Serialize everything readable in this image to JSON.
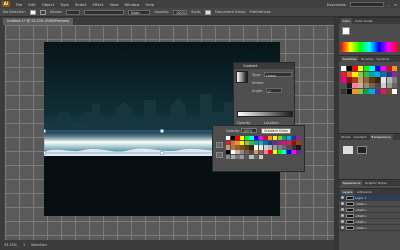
{
  "menubar": {
    "logo": "Ai",
    "items": [
      "File",
      "Edit",
      "Object",
      "Type",
      "Select",
      "Effect",
      "View",
      "Window",
      "Help"
    ],
    "workspace": "Essentials"
  },
  "controlbar": {
    "selection_label": "No Selection",
    "stroke_label": "Stroke:",
    "brush_value": "Basic",
    "opacity_label": "Opacity:",
    "opacity_value": "100%",
    "style_label": "Style:",
    "doc_setup": "Document Setup",
    "preferences": "Preferences"
  },
  "document": {
    "tab_title": "Untitled-1* @ 33.33% (RGB/Preview)"
  },
  "status": {
    "zoom": "33.33%",
    "page": "1",
    "tool": "Selection"
  },
  "gradient_panel": {
    "title": "Gradient",
    "type_label": "Type:",
    "type_value": "Linear",
    "stroke_label": "Stroke:",
    "angle_label": "Angle:",
    "angle_value": "0°",
    "opacity_label": "Opacity:",
    "location_label": "Location:"
  },
  "swatch_popup": {
    "opacity_label": "Opacity:",
    "opacity_value": "100%",
    "tooltip": "Gradient Slider",
    "colors": [
      "#ffffff",
      "#000000",
      "#ff0000",
      "#ffff00",
      "#00ff00",
      "#00ffff",
      "#0000ff",
      "#ff00ff",
      "#c8102e",
      "#f7941d",
      "#fff200",
      "#8dc63f",
      "#00a651",
      "#00aeef",
      "#2e3192",
      "#92278f",
      "#ed1c24",
      "#f26522",
      "#f7941d",
      "#fff200",
      "#8dc63f",
      "#39b54a",
      "#00a99d",
      "#00aeef",
      "#0072bc",
      "#2e3192",
      "#662d91",
      "#92278f",
      "#ec008c",
      "#ed145b",
      "#9e0b0f",
      "#a0410d",
      "#c69c6d",
      "#a67c52",
      "#8c6239",
      "#754c24",
      "#603913",
      "#42210b",
      "#ffffff",
      "#e6e6e6",
      "#cccccc",
      "#b3b3b3",
      "#999999",
      "#808080",
      "#666666",
      "#4d4d4d",
      "#333333",
      "#1a1a1a",
      "#000000",
      "#ffffff",
      "#c7b299",
      "#998675",
      "#736357",
      "#534741",
      "#c69c6d",
      "#8c6239",
      "#ff7bac",
      "#ff0000",
      "#ffff00",
      "#00ff00",
      "#00ffff",
      "#0000ff",
      "#ff00ff",
      "#662d91",
      "#888888",
      "#aaaaaa",
      "#777777",
      "#999999",
      "#555555",
      "#bbbbbb",
      "#666666",
      "#cccccc"
    ]
  },
  "right_dock": {
    "color_tabs": [
      "Color",
      "Color Guide"
    ],
    "swatch_tabs": [
      "Swatches",
      "Brushes",
      "Symbols"
    ],
    "stroke_tabs": [
      "Stroke",
      "Gradient",
      "Transparency"
    ],
    "appearance_tabs": [
      "Appearance",
      "Graphic Styles"
    ],
    "layers_tabs": [
      "Layers",
      "Artboards"
    ],
    "layers": [
      {
        "name": "Layer 1",
        "selected": true
      },
      {
        "name": "<Path>",
        "selected": false
      },
      {
        "name": "<Path>",
        "selected": false
      },
      {
        "name": "<Path>",
        "selected": false
      },
      {
        "name": "<Path>",
        "selected": false
      },
      {
        "name": "<Path>",
        "selected": false
      }
    ],
    "dock_swatches": [
      "#ffffff",
      "#000000",
      "#ff0000",
      "#ffff00",
      "#00ff00",
      "#00ffff",
      "#0000ff",
      "#ff00ff",
      "#c8102e",
      "#f7941d",
      "#ed1c24",
      "#f26522",
      "#fff200",
      "#8dc63f",
      "#39b54a",
      "#00a99d",
      "#00aeef",
      "#0072bc",
      "#2e3192",
      "#92278f",
      "#ec008c",
      "#9e0b0f",
      "#a0410d",
      "#c69c6d",
      "#8c6239",
      "#603913",
      "#42210b",
      "#e6e6e6",
      "#b3b3b3",
      "#808080",
      "#4d4d4d",
      "#1a1a1a",
      "#ff7bac",
      "#c7b299",
      "#998675",
      "#736357",
      "#534741",
      "#cccccc",
      "#999999",
      "#666666",
      "#333333",
      "#000000",
      "#f7941d",
      "#8dc63f",
      "#00a651",
      "#00aeef",
      "#662d91",
      "#ed145b",
      "#754c24",
      "#ffffff"
    ]
  },
  "colors": {
    "accent": "#f0a436",
    "sky_top": "#071418",
    "sky_mid": "#1c4b57"
  }
}
